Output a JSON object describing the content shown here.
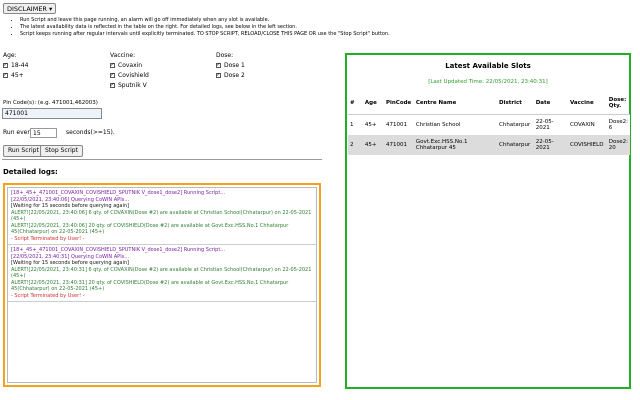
{
  "disclaimer": {
    "label": "DISCLAIMER",
    "arrow": "▾"
  },
  "notes": [
    "Run Script and leave this page running, an alarm will go off immediately when any slot is available.",
    "The latest availability data is reflected in the table on the right. For detailed logs, see below in the left section.",
    "Script keeps running after regular intervals until explicitly terminated. TO STOP SCRIPT, RELOAD/CLOSE THIS PAGE OR use the \"Stop Script\" button."
  ],
  "filters": {
    "age": {
      "label": "Age:",
      "options": [
        "18-44",
        "45+"
      ]
    },
    "vaccine": {
      "label": "Vaccine:",
      "options": [
        "Covaxin",
        "Covishield",
        "Sputnik V"
      ]
    },
    "dose": {
      "label": "Dose:",
      "options": [
        "Dose 1",
        "Dose 2"
      ]
    },
    "check": "✓"
  },
  "pincode": {
    "label": "Pin Code(s): (e.g. 471001,462003)",
    "value": "471001"
  },
  "interval": {
    "prefix": "Run every",
    "value": "15",
    "suffix": "seconds(>=15)."
  },
  "buttons": {
    "run": "Run Script",
    "stop": "Stop Script"
  },
  "logs": {
    "title": "Detailed logs:",
    "blocks": [
      {
        "header": "[18+_45+_471001_COVAXIN_COVISHIELD_SPUTNIK V_dose1_dose2] Running Script...",
        "query": "[22/05/2021, 23:40:06] Querying CoWIN APIs...",
        "wait": "[Waiting for 15 seconds before querying again]",
        "alerts": [
          "ALERT![22/05/2021, 23:40:06] 6 qty. of COVAXIN(Dose #2) are available at Christian School(Chhatarpur) on 22-05-2021 (45+)",
          "ALERT![22/05/2021, 23:40:06] 20 qty. of COVISHIELD(Dose #2) are available at Govt.Exc.HSS.No.1 Chhatarpur 45(Chhatarpur) on 22-05-2021 (45+)"
        ],
        "terminated": "- Script Terminated by User! -"
      },
      {
        "header": "[18+_45+_471001_COVAXIN_COVISHIELD_SPUTNIK V_dose1_dose2] Running Script...",
        "query": "[22/05/2021, 23:40:31] Querying CoWIN APIs...",
        "wait": "[Waiting for 15 seconds before querying again]",
        "alerts": [
          "ALERT![22/05/2021, 23:40:31] 6 qty. of COVAXIN(Dose #2) are available at Christian School(Chhatarpur) on 22-05-2021 (45+)",
          "ALERT![22/05/2021, 23:40:31] 20 qty. of COVISHIELD(Dose #2) are available at Govt.Exc.HSS.No.1 Chhatarpur 45(Chhatarpur) on 22-05-2021 (45+)"
        ],
        "terminated": "- Script Terminated by User! -"
      }
    ]
  },
  "slots": {
    "title": "Latest Available Slots",
    "updated": "[Last Updated Time: 22/05/2021, 23:40:31]",
    "columns": [
      "#",
      "Age",
      "PinCode",
      "Centre Name",
      "District",
      "Date",
      "Vaccine",
      "Dose: Qty."
    ],
    "rows": [
      [
        "1",
        "45+",
        "471001",
        "Christian School",
        "Chhatarpur",
        "22-05-2021",
        "COVAXIN",
        "Dose2: 6"
      ],
      [
        "2",
        "45+",
        "471001",
        "Govt.Exc.HSS.No.1 Chhatarpur 45",
        "Chhatarpur",
        "22-05-2021",
        "COVISHIELD",
        "Dose2: 20"
      ]
    ]
  }
}
